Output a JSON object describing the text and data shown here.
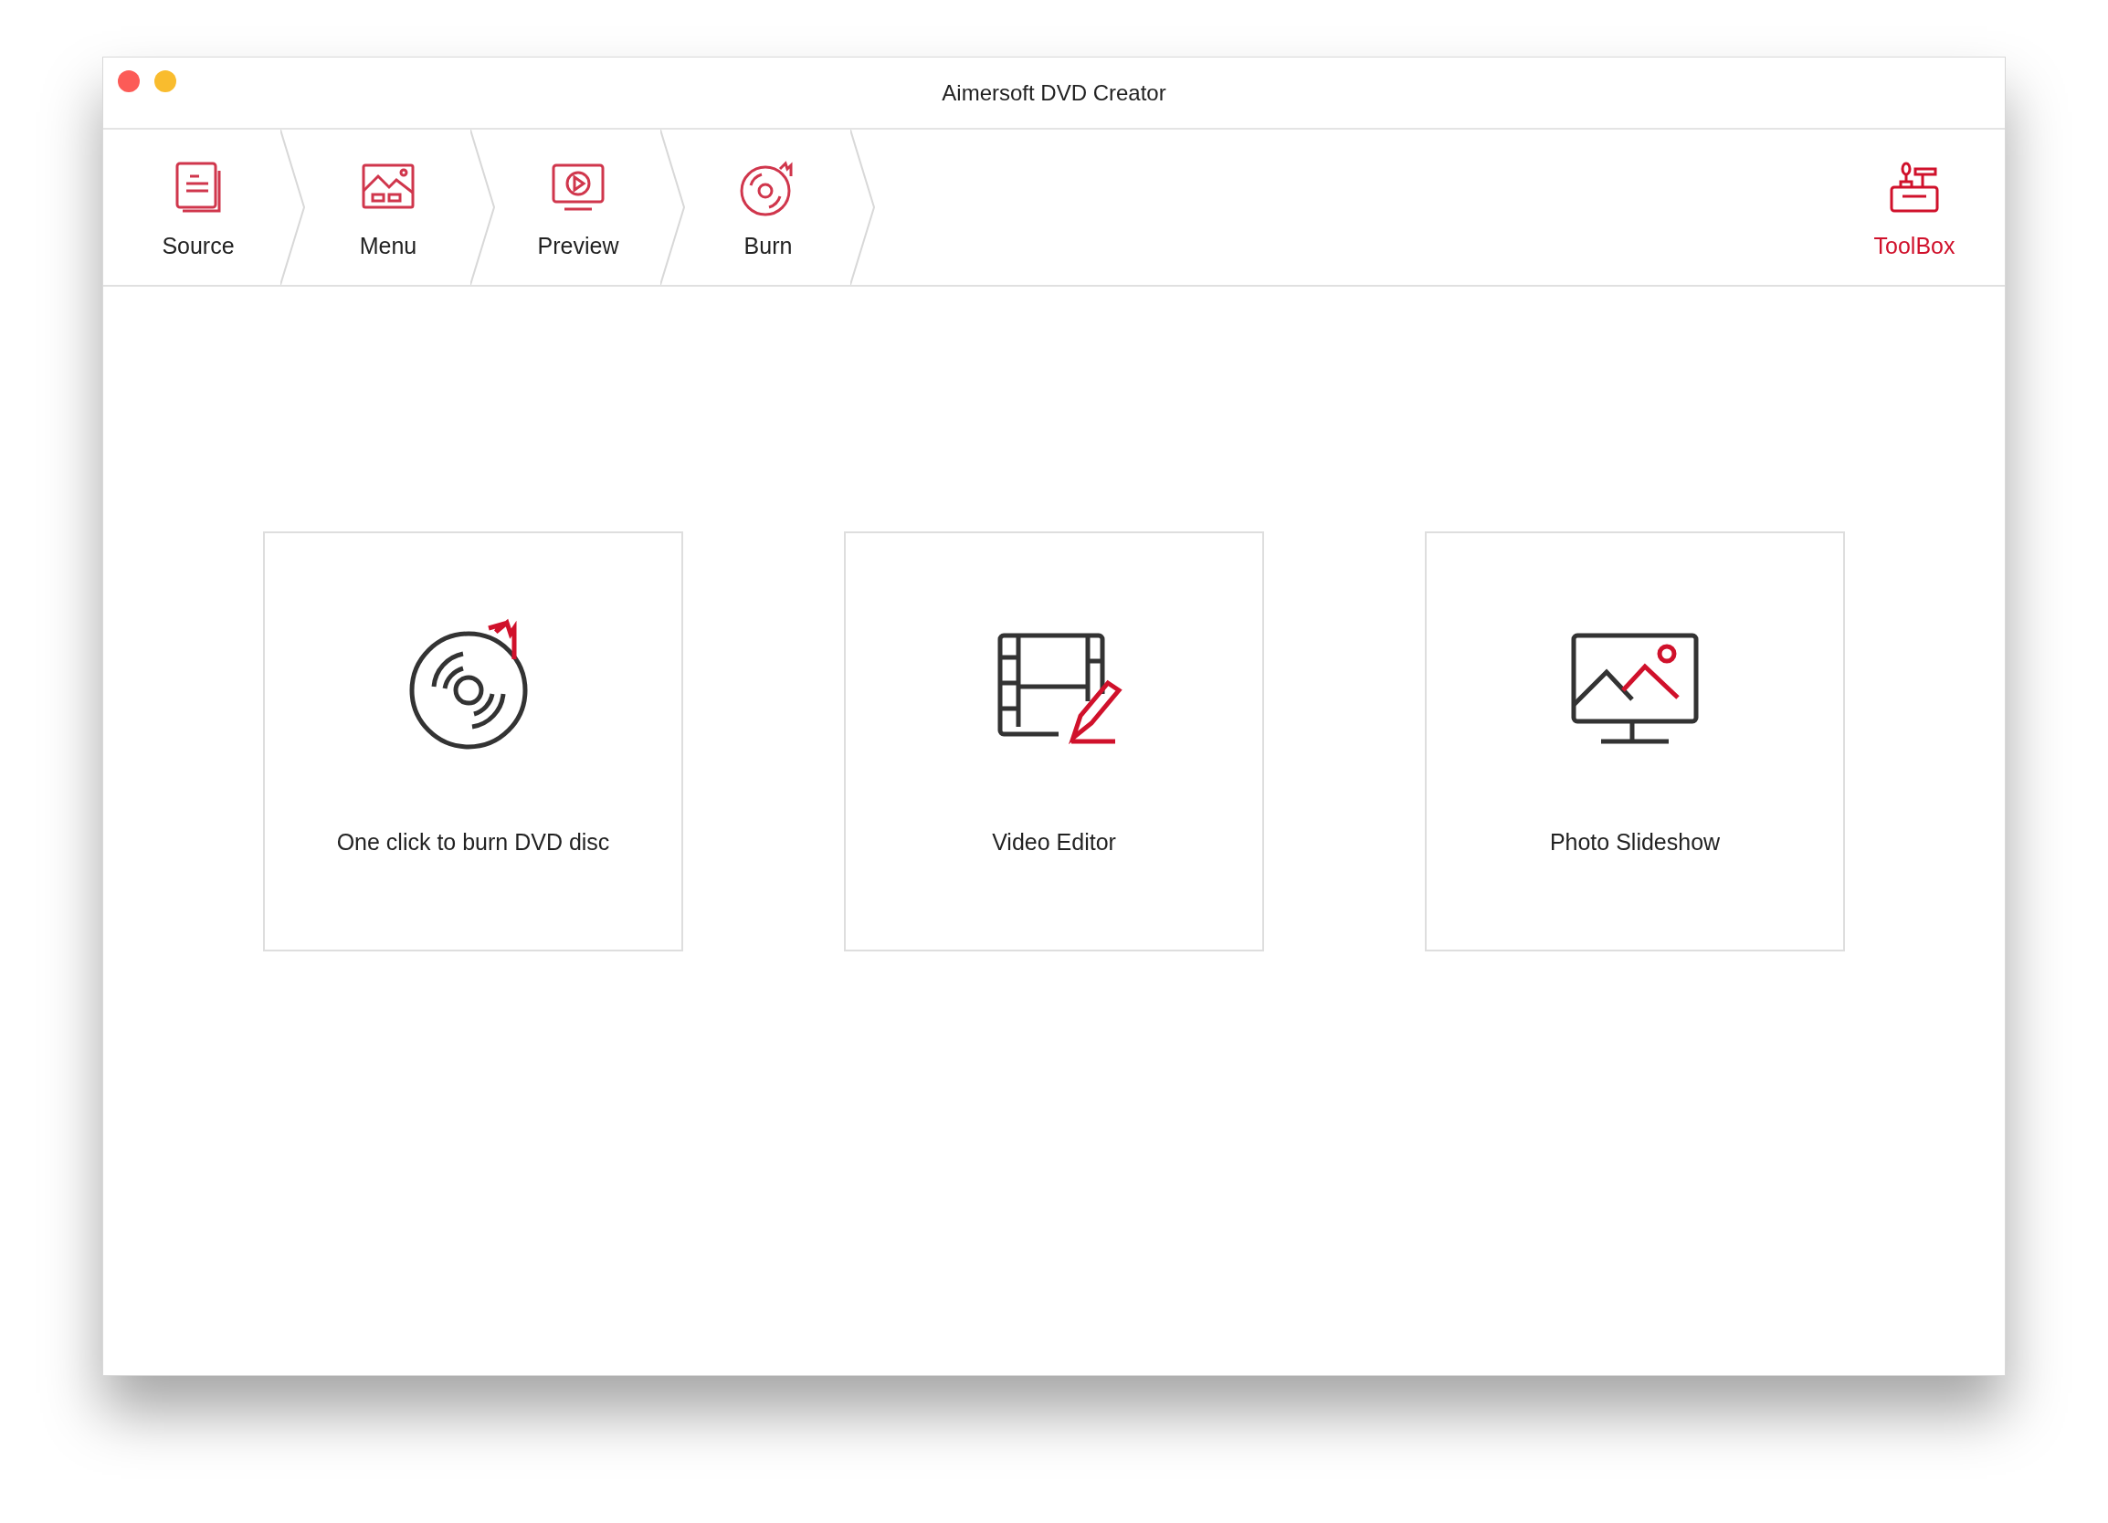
{
  "window": {
    "title": "Aimersoft DVD Creator"
  },
  "steps": [
    {
      "label": "Source",
      "kind": "source"
    },
    {
      "label": "Menu",
      "kind": "menu"
    },
    {
      "label": "Preview",
      "kind": "preview"
    },
    {
      "label": "Burn",
      "kind": "burn"
    }
  ],
  "toolbox": {
    "label": "ToolBox"
  },
  "cards": [
    {
      "label": "One click to burn DVD disc",
      "kind": "burn"
    },
    {
      "label": "Video Editor",
      "kind": "editor"
    },
    {
      "label": "Photo Slideshow",
      "kind": "slideshow"
    }
  ]
}
